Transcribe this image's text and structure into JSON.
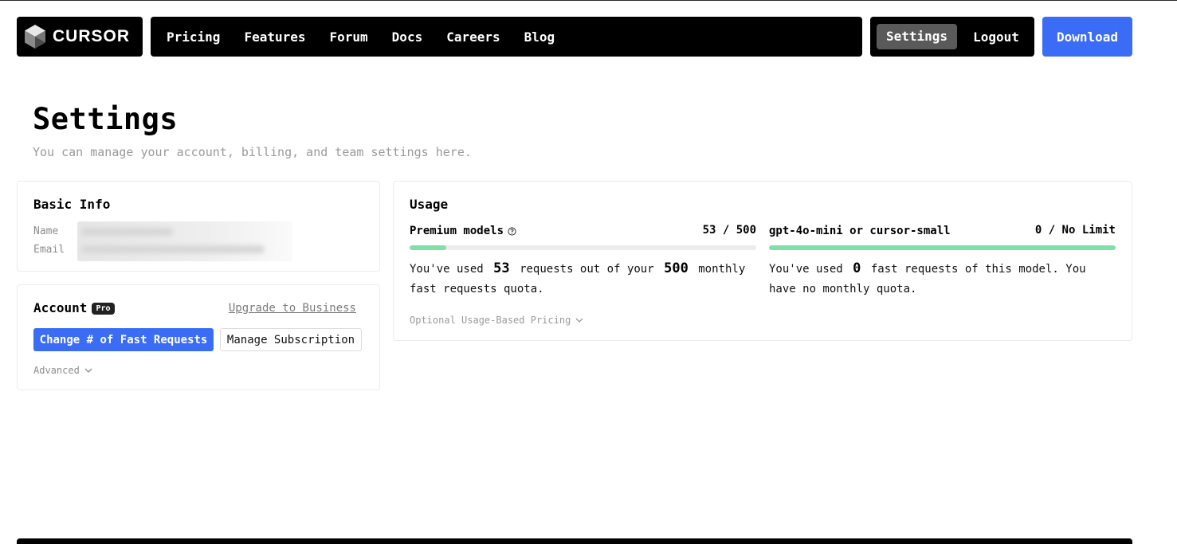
{
  "nav": {
    "logo_text": "CURSOR",
    "links": [
      "Pricing",
      "Features",
      "Forum",
      "Docs",
      "Careers",
      "Blog"
    ],
    "settings_label": "Settings",
    "logout_label": "Logout",
    "download_label": "Download"
  },
  "header": {
    "title": "Settings",
    "subtitle": "You can manage your account, billing, and team settings here."
  },
  "basic_info": {
    "title": "Basic Info",
    "name_label": "Name",
    "email_label": "Email"
  },
  "account": {
    "title": "Account",
    "plan_badge": "Pro",
    "upgrade_link": "Upgrade to Business",
    "change_requests_button": "Change # of Fast Requests",
    "manage_subscription_button": "Manage Subscription",
    "advanced_label": "Advanced"
  },
  "usage": {
    "title": "Usage",
    "premium": {
      "label": "Premium models",
      "count": "53 / 500",
      "used": "53",
      "quota": "500",
      "fill_fraction": 0.106,
      "desc_pre": "You've used",
      "desc_mid": "requests out of your",
      "desc_post": "monthly fast requests quota."
    },
    "small": {
      "label": "gpt-4o-mini or cursor-small",
      "count": "0 / No Limit",
      "used": "0",
      "fill_fraction": 1.0,
      "desc_pre": "You've used",
      "desc_post": "fast requests of this model. You have no monthly quota."
    },
    "optional_label": "Optional Usage-Based Pricing"
  },
  "colors": {
    "accent": "#3b6cf6",
    "progress": "#7ee2a8",
    "nav_bg": "#000000",
    "active_tab_bg": "#5a5a5a"
  },
  "icons": [
    "cursor-logo-icon",
    "help-circle-icon",
    "chevron-down-icon"
  ]
}
